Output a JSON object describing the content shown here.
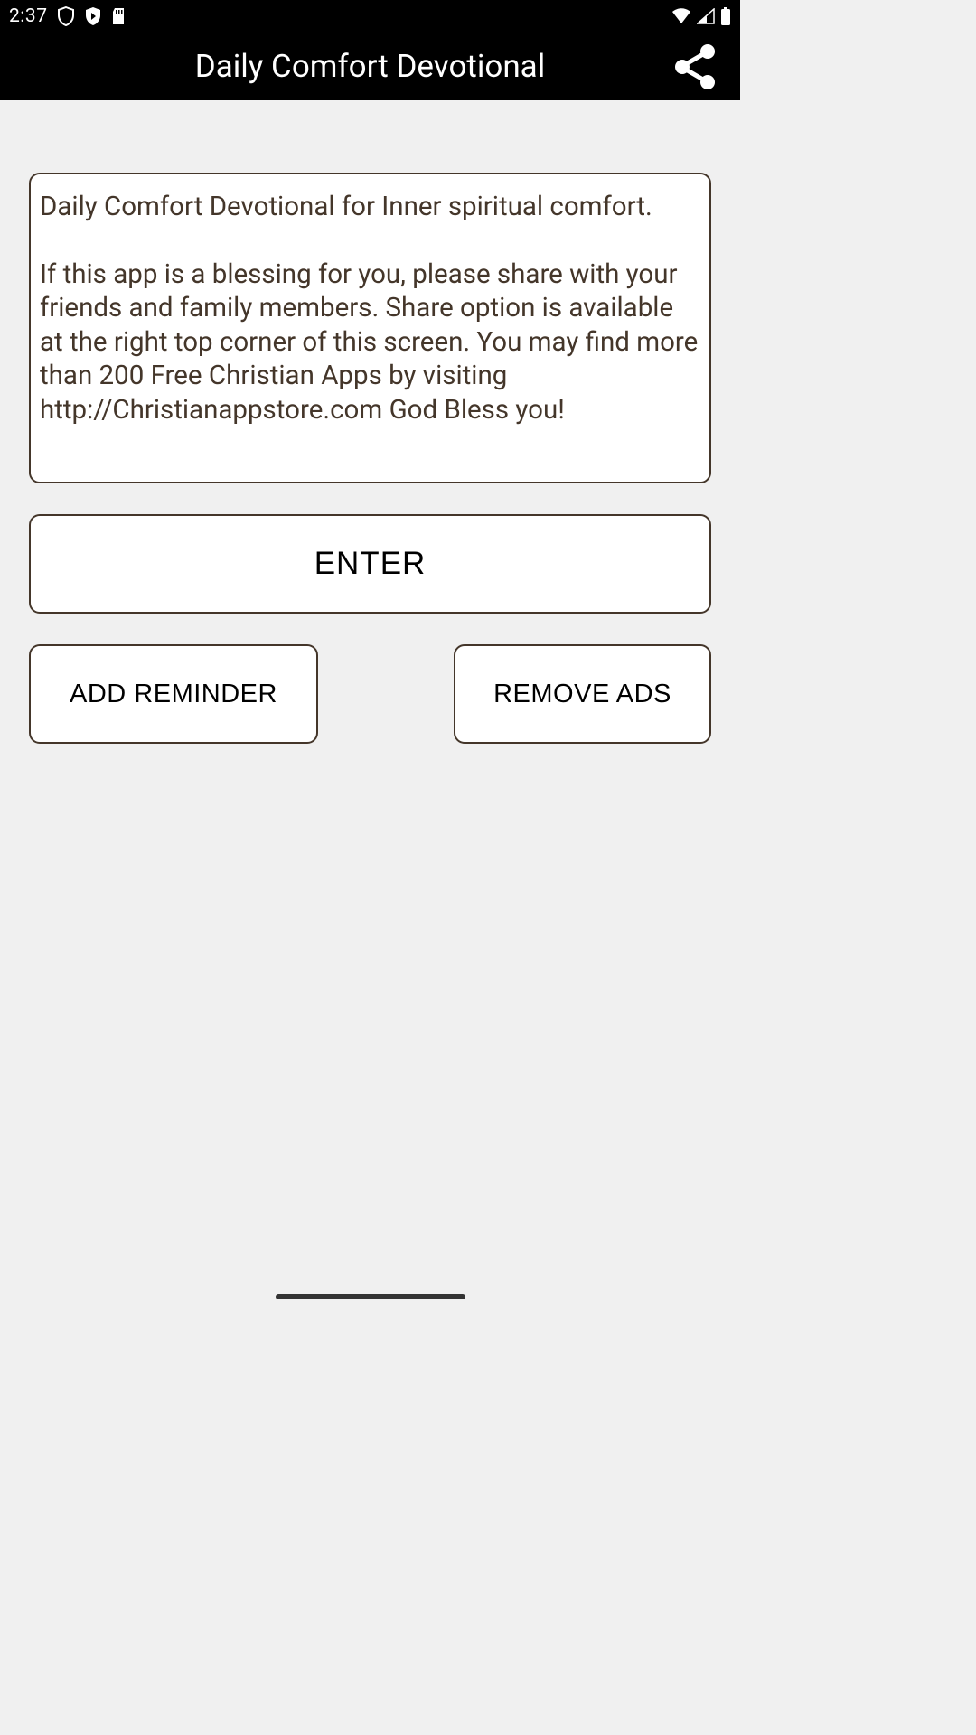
{
  "status": {
    "time": "2:37"
  },
  "header": {
    "title": "Daily Comfort Devotional"
  },
  "card": {
    "text": "Daily Comfort Devotional for Inner spiritual comfort.\n\nIf this app is a blessing for you, please share with your friends and family members. Share option is available at the right top corner of this screen. You may find more than 200 Free Christian Apps by visiting http://Christianappstore.com God Bless you!"
  },
  "buttons": {
    "enter": "ENTER",
    "add_reminder": "ADD REMINDER",
    "remove_ads": "REMOVE ADS"
  }
}
